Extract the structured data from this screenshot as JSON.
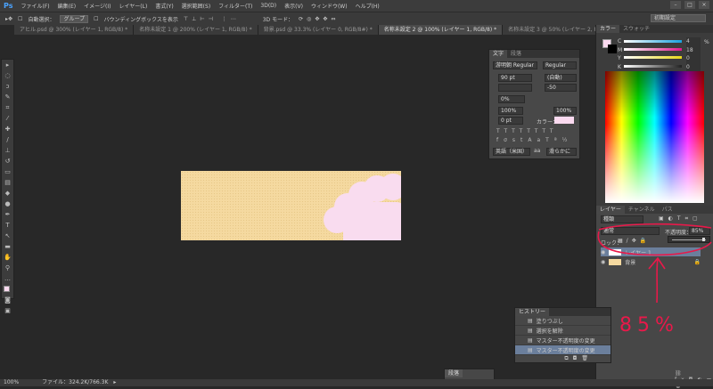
{
  "app": {
    "logo": "Ps"
  },
  "menu": [
    "ファイル(F)",
    "編集(E)",
    "イメージ(I)",
    "レイヤー(L)",
    "書式(Y)",
    "選択範囲(S)",
    "フィルター(T)",
    "3D(D)",
    "表示(V)",
    "ウィンドウ(W)",
    "ヘルプ(H)"
  ],
  "options": {
    "auto_select": "自動選択：",
    "auto_select_value": "グループ",
    "bbox": "バウンディングボックスを表示",
    "mode3d": "3D モード：",
    "workspace": "初期設定"
  },
  "tabs": [
    {
      "label": "アヒル.psd @ 300% (レイヤー 1, RGB/8) *",
      "active": false
    },
    {
      "label": "名称未設定 1 @ 200% (レイヤー 1, RGB/8) *",
      "active": false
    },
    {
      "label": "背景.psd @ 33.3% (レイヤー 0, RGB/8#) *",
      "active": false
    },
    {
      "label": "名称未設定 2 @ 100% (レイヤー 1, RGB/8) *",
      "active": true
    },
    {
      "label": "名称未設定 3 @ 50% (レイヤー 2, RGB/8) *",
      "active": false
    }
  ],
  "character": {
    "tabs": [
      "文字",
      "段落"
    ],
    "font": "游明朝 Regular",
    "style": "Regular",
    "size": "90 pt",
    "leading": "(自動)",
    "kerning": "",
    "tracking": "-50",
    "tsume": "0%",
    "vscale": "100%",
    "hscale": "100%",
    "baseline": "0 pt",
    "color_label": "カラー：",
    "color": "#fbdaf0",
    "lang": "英語（米国）",
    "aa_icon": "aa",
    "aa": "滑らかに"
  },
  "color_panel": {
    "tabs": [
      "カラー",
      "スウォッチ"
    ],
    "channels": [
      {
        "label": "C",
        "value": "4",
        "color": "#1aa3e0"
      },
      {
        "label": "M",
        "value": "18",
        "color": "#e0198c"
      },
      {
        "label": "Y",
        "value": "0",
        "color": "#e8d81a"
      },
      {
        "label": "K",
        "value": "0",
        "color": "#222222"
      }
    ],
    "unit": "%"
  },
  "layers": {
    "tabs": [
      "レイヤー",
      "チャンネル",
      "パス"
    ],
    "filter": "種類",
    "blend": "通常",
    "opacity_label": "不透明度：",
    "opacity": "85%",
    "opacity_value": 85,
    "lock_label": "ロック：",
    "items": [
      {
        "name": "レイヤー 1",
        "selected": true
      },
      {
        "name": "背景",
        "selected": false
      }
    ]
  },
  "history": {
    "title": "ヒストリー",
    "items": [
      {
        "label": "塗りつぶし",
        "selected": false
      },
      {
        "label": "選択を解除",
        "selected": false
      },
      {
        "label": "マスター不透明度の変更",
        "selected": false
      },
      {
        "label": "マスター不透明度の変更",
        "selected": true
      }
    ]
  },
  "annotation": {
    "text": "85%",
    "color": "#e8194a"
  },
  "paragraph": {
    "title": "段落"
  },
  "status": {
    "zoom": "100%",
    "file": "ファイル：324.2K/766.3K"
  }
}
